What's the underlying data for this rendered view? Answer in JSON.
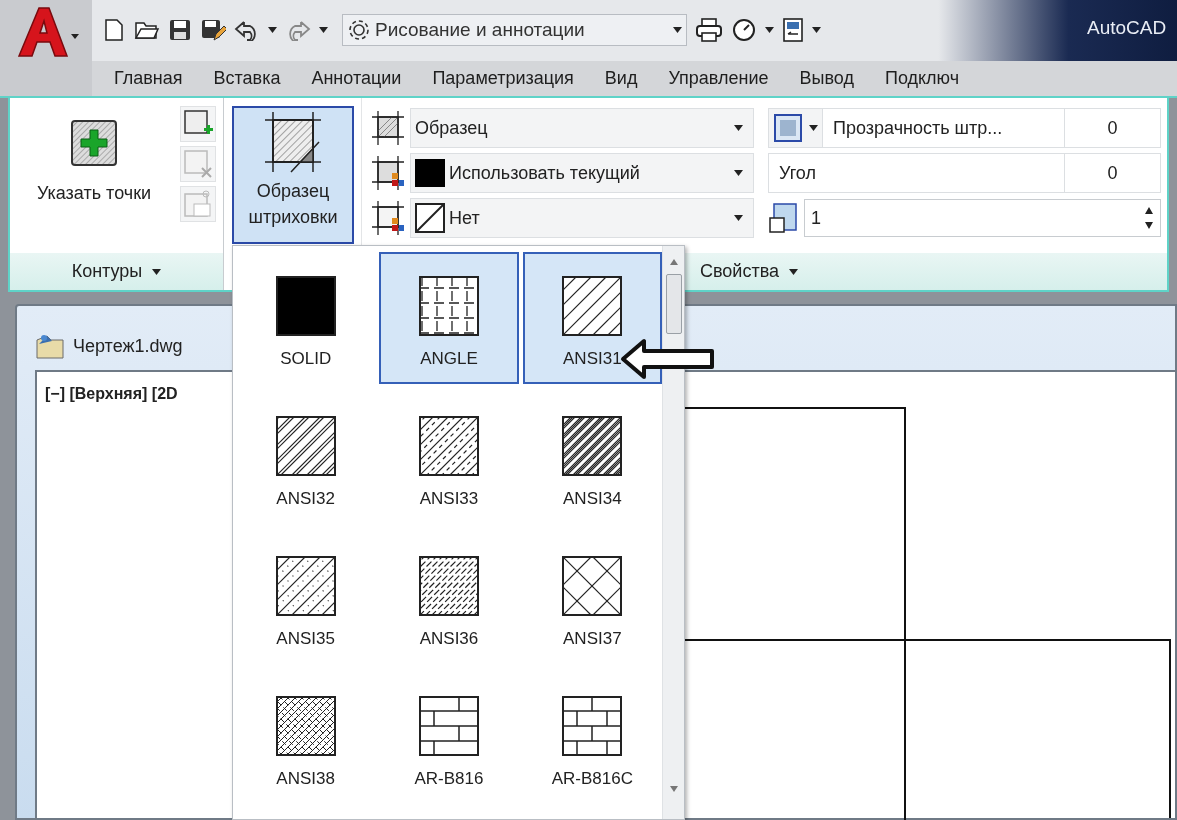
{
  "quick_access": {
    "workspace": "Рисование и аннотации"
  },
  "title": "AutoCAD",
  "ribbon_tabs": [
    {
      "label": "Главная"
    },
    {
      "label": "Вставка"
    },
    {
      "label": "Аннотации"
    },
    {
      "label": "Параметризация"
    },
    {
      "label": "Вид"
    },
    {
      "label": "Управление"
    },
    {
      "label": "Вывод"
    },
    {
      "label": "Подключ"
    }
  ],
  "ribbon": {
    "pick_points": "Указать точки",
    "contours_label": "Контуры",
    "pattern_button": {
      "label": "Образец штриховки",
      "selected": true
    },
    "type_rows": [
      {
        "kind": "pattern",
        "value": "Образец"
      },
      {
        "kind": "color",
        "value": "Использовать текущий"
      },
      {
        "kind": "background",
        "value": "Нет"
      }
    ],
    "transparency": {
      "label": "Прозрачность штр...",
      "value": "0"
    },
    "angle": {
      "label": "Угол",
      "value": "0"
    },
    "scale": {
      "value": "1"
    },
    "properties_label": "Свойства"
  },
  "document_tab": "Чертеж1.dwg",
  "viewport_label": "[−] [Верхняя] [2D",
  "pattern_gallery": {
    "items": [
      {
        "name": "SOLID",
        "kind": "solid",
        "selected": false
      },
      {
        "name": "ANGLE",
        "kind": "angle",
        "selected": true
      },
      {
        "name": "ANSI31",
        "kind": "ansi31",
        "selected": true
      },
      {
        "name": "ANSI32",
        "kind": "ansi32",
        "selected": false
      },
      {
        "name": "ANSI33",
        "kind": "ansi33",
        "selected": false
      },
      {
        "name": "ANSI34",
        "kind": "ansi34",
        "selected": false
      },
      {
        "name": "ANSI35",
        "kind": "ansi35",
        "selected": false
      },
      {
        "name": "ANSI36",
        "kind": "ansi36",
        "selected": false
      },
      {
        "name": "ANSI37",
        "kind": "ansi37",
        "selected": false
      },
      {
        "name": "ANSI38",
        "kind": "ansi38",
        "selected": false
      },
      {
        "name": "AR-B816",
        "kind": "brick",
        "selected": false
      },
      {
        "name": "AR-B816C",
        "kind": "brick_c",
        "selected": false
      }
    ]
  }
}
